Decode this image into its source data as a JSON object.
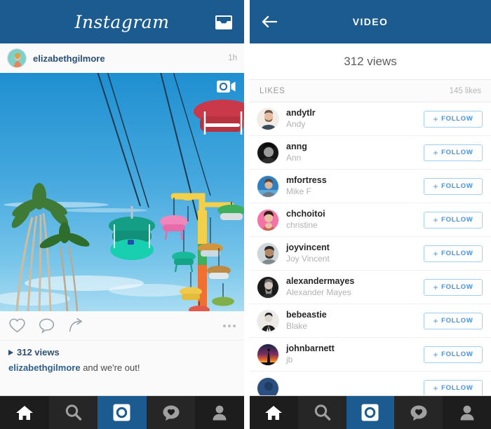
{
  "theme": {
    "brand_blue": "#1b5b8f",
    "follow_blue": "#4a90d9",
    "follow_border": "#a7cdeb",
    "nav_dark": "#1d1d1d",
    "username_blue": "#2f5f8f"
  },
  "left_panel": {
    "header": {
      "wordmark": "Instagram",
      "inbox_icon": "inbox-icon"
    },
    "post": {
      "username": "elizabethgilmore",
      "timestamp": "1h",
      "avatar_icon": "user-avatar",
      "media_type_badge": "video-camera-icon",
      "photo_alt": "fairground sky ride gondolas against blue sky with palm trees"
    },
    "actions": {
      "like_icon": "heart-icon",
      "comment_icon": "comment-bubble-icon",
      "share_icon": "share-arrow-icon",
      "more_icon": "more-options-icon"
    },
    "caption": {
      "views_label": "312 views",
      "play_icon": "play-triangle-icon",
      "caption_username": "elizabethgilmore",
      "caption_text": " and we're out!"
    }
  },
  "right_panel": {
    "header": {
      "back_icon": "back-arrow-icon",
      "title": "VIDEO"
    },
    "views_count": "312 views",
    "likes_section": {
      "label": "LIKES",
      "count": "145 likes"
    },
    "follow_button_label": "FOLLOW",
    "follow_button_plus": "+",
    "likers": [
      {
        "username": "andytlr",
        "fullname": "Andy",
        "avatar": "avatar-andytlr"
      },
      {
        "username": "anng",
        "fullname": "Ann",
        "avatar": "avatar-anng"
      },
      {
        "username": "mfortress",
        "fullname": "Mike F",
        "avatar": "avatar-mfortress"
      },
      {
        "username": "chchoitoi",
        "fullname": "christine",
        "avatar": "avatar-chchoitoi"
      },
      {
        "username": "joyvincent",
        "fullname": "Joy Vincent",
        "avatar": "avatar-joyvincent"
      },
      {
        "username": "alexandermayes",
        "fullname": "Alexander Mayes",
        "avatar": "avatar-alexandermayes"
      },
      {
        "username": "bebeastie",
        "fullname": "Blake",
        "avatar": "avatar-bebeastie"
      },
      {
        "username": "johnbarnett",
        "fullname": "jb",
        "avatar": "avatar-johnbarnett"
      }
    ]
  },
  "bottom_nav": {
    "items": [
      {
        "icon": "home-icon",
        "active": false
      },
      {
        "icon": "search-icon",
        "active": false
      },
      {
        "icon": "camera-icon",
        "active": true
      },
      {
        "icon": "activity-heart-icon",
        "active": false
      },
      {
        "icon": "profile-icon",
        "active": false
      }
    ]
  }
}
